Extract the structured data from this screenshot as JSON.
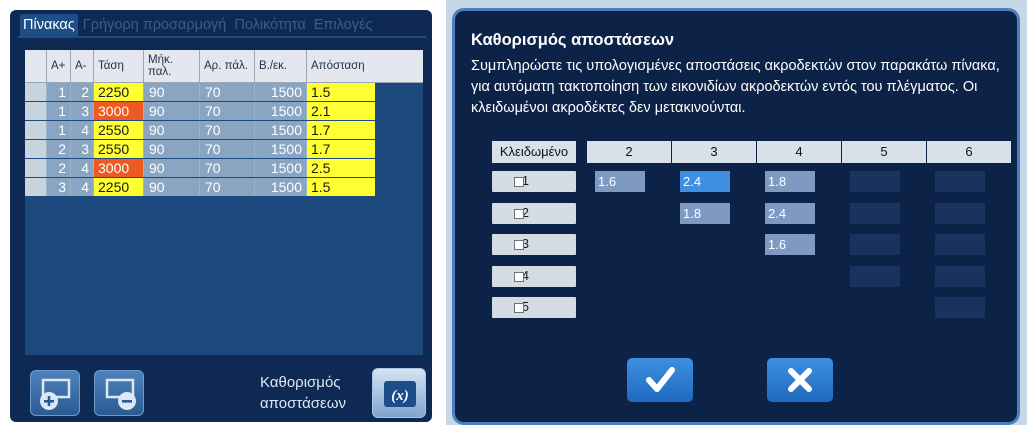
{
  "left_panel": {
    "tabs": [
      "Πίνακας",
      "Γρήγορη προσαρμογή",
      "Πολικότητα",
      "Επιλογές"
    ],
    "table": {
      "headers": [
        "",
        "A+",
        "A-",
        "Τάση",
        "Μήκ.\nπαλ.",
        "Αρ. πάλ.",
        "Β./εκ.",
        "Απόσταση"
      ],
      "rows": [
        {
          "a_plus": "1",
          "a_minus": "2",
          "voltage": "2250",
          "pulse_len": "90",
          "pulses": "70",
          "rate": "1500",
          "distance": "1.5",
          "voltage_highlight": false
        },
        {
          "a_plus": "1",
          "a_minus": "3",
          "voltage": "3000",
          "pulse_len": "90",
          "pulses": "70",
          "rate": "1500",
          "distance": "2.1",
          "voltage_highlight": true
        },
        {
          "a_plus": "1",
          "a_minus": "4",
          "voltage": "2550",
          "pulse_len": "90",
          "pulses": "70",
          "rate": "1500",
          "distance": "1.7",
          "voltage_highlight": false
        },
        {
          "a_plus": "2",
          "a_minus": "3",
          "voltage": "2550",
          "pulse_len": "90",
          "pulses": "70",
          "rate": "1500",
          "distance": "1.7",
          "voltage_highlight": false
        },
        {
          "a_plus": "2",
          "a_minus": "4",
          "voltage": "3000",
          "pulse_len": "90",
          "pulses": "70",
          "rate": "1500",
          "distance": "2.5",
          "voltage_highlight": true
        },
        {
          "a_plus": "3",
          "a_minus": "4",
          "voltage": "2250",
          "pulse_len": "90",
          "pulses": "70",
          "rate": "1500",
          "distance": "1.5",
          "voltage_highlight": false
        }
      ]
    },
    "buttons": {
      "add_row_icon": "add-row-icon",
      "remove_row_icon": "remove-row-icon",
      "calc_label_line1": "Καθορισμός",
      "calc_label_line2": "αποστάσεων",
      "calc_icon_text": "(x)"
    },
    "colors": {
      "highlight_voltage": "#ee5a22",
      "yellow": "#ffff33"
    }
  },
  "dialog": {
    "title": "Καθορισμός αποστάσεων",
    "description": "Συμπληρώστε τις υπολογισμένες αποστάσεις ακροδεκτών στον παρακάτω πίνακα, για αυτόματη τακτοποίηση των εικονιδίων ακροδεκτών εντός του πλέγματος. Οι κλειδωμένοι ακροδέκτες δεν μετακινούνται.",
    "grid": {
      "locked_header": "Κλειδωμένο",
      "columns": [
        "2",
        "3",
        "4",
        "5",
        "6"
      ],
      "rows": [
        {
          "label": "1",
          "locked": false,
          "cells": [
            {
              "value": "1.6",
              "state": "filled"
            },
            {
              "value": "2.4",
              "state": "active"
            },
            {
              "value": "1.8",
              "state": "filled"
            },
            {
              "value": "",
              "state": "empty"
            },
            {
              "value": "",
              "state": "empty"
            }
          ]
        },
        {
          "label": "2",
          "locked": false,
          "cells": [
            null,
            {
              "value": "1.8",
              "state": "filled"
            },
            {
              "value": "2.4",
              "state": "filled"
            },
            {
              "value": "",
              "state": "empty"
            },
            {
              "value": "",
              "state": "empty"
            }
          ]
        },
        {
          "label": "3",
          "locked": false,
          "cells": [
            null,
            null,
            {
              "value": "1.6",
              "state": "filled"
            },
            {
              "value": "",
              "state": "empty"
            },
            {
              "value": "",
              "state": "empty"
            }
          ]
        },
        {
          "label": "4",
          "locked": false,
          "cells": [
            null,
            null,
            null,
            {
              "value": "",
              "state": "empty"
            },
            {
              "value": "",
              "state": "empty"
            }
          ]
        },
        {
          "label": "5",
          "locked": false,
          "cells": [
            null,
            null,
            null,
            null,
            {
              "value": "",
              "state": "empty"
            }
          ]
        }
      ]
    },
    "confirm_icon": "checkmark-icon",
    "cancel_icon": "close-icon"
  }
}
